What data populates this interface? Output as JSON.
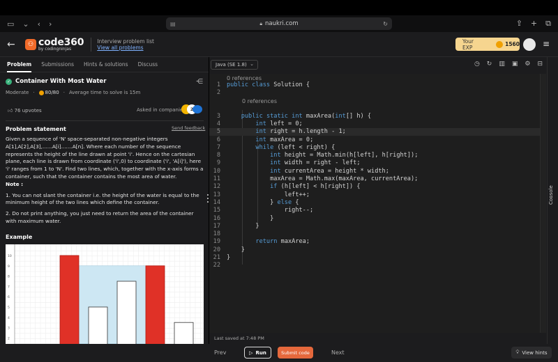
{
  "browser": {
    "url": "naukri.com"
  },
  "header": {
    "logo_main": "code360",
    "logo_sub": "by codingninjas",
    "link_title": "Interview problem list",
    "link_text": "View all problems",
    "exp_label": "Your EXP",
    "exp_value": "1560"
  },
  "left_tabs": [
    "Problem",
    "Submissions",
    "Hints & solutions",
    "Discuss"
  ],
  "problem": {
    "title": "Container With Most Water",
    "difficulty": "Moderate",
    "score": "80/80",
    "avg_time": "Average time to solve is 15m",
    "upvotes": "76 upvotes",
    "asked_in": "Asked in companies",
    "statement_heading": "Problem statement",
    "send_feedback": "Send feedback",
    "statement": "Given a sequence of 'N' space-separated non-negative integers A[1],A[2],A[3],......A[i].......A[n]. Where each number of the sequence represents the height of the line drawn at point 'i'. Hence on the cartesian plane, each line is drawn from coordinate ('i',0) to coordinate ('i', 'A[i]'), here 'i' ranges from 1 to 'N'. Find two lines, which, together with the x-axis forms a container, such that the container contains the most area of water.",
    "note_label": "Note :",
    "note1": "1. You can not slant the container i.e. the height of the water is equal to the minimum height of the two lines which define the container.",
    "note2": "2. Do not print anything, you just need to return the area of the container with maximum water.",
    "example_heading": "Example"
  },
  "chart_data": {
    "type": "bar",
    "y_ticks": [
      "10",
      "9",
      "8",
      "7",
      "6",
      "5",
      "4",
      "3",
      "2"
    ],
    "values": [
      10,
      5,
      7.5,
      9,
      3.5
    ],
    "highlighted": [
      true,
      false,
      false,
      true,
      false
    ],
    "water_level": 9,
    "colors": {
      "highlight": "#e03127",
      "normal": "#ffffff",
      "water": "#cde7f3"
    }
  },
  "editor": {
    "language": "Java (SE 1.8)",
    "references_1": "0 references",
    "references_2": "0 references",
    "last_saved": "Last saved at 7:48 PM",
    "lines": [
      "public class Solution {",
      "",
      "    public static int maxArea(int[] h) {",
      "        int left = 0;",
      "        int right = h.length - 1;",
      "        int maxArea = 0;",
      "        while (left < right) {",
      "            int height = Math.min(h[left], h[right]);",
      "            int width = right - left;",
      "            int currentArea = height * width;",
      "            maxArea = Math.max(maxArea, currentArea);",
      "            if (h[left] < h[right]) {",
      "                left++;",
      "            } else {",
      "                right--;",
      "            }",
      "        }",
      "",
      "        return maxArea;",
      "    }",
      "}",
      ""
    ]
  },
  "console_label": "Console",
  "bottom": {
    "prev": "Prev",
    "run": "Run",
    "submit": "Submit code",
    "next": "Next",
    "hints": "View hints"
  }
}
